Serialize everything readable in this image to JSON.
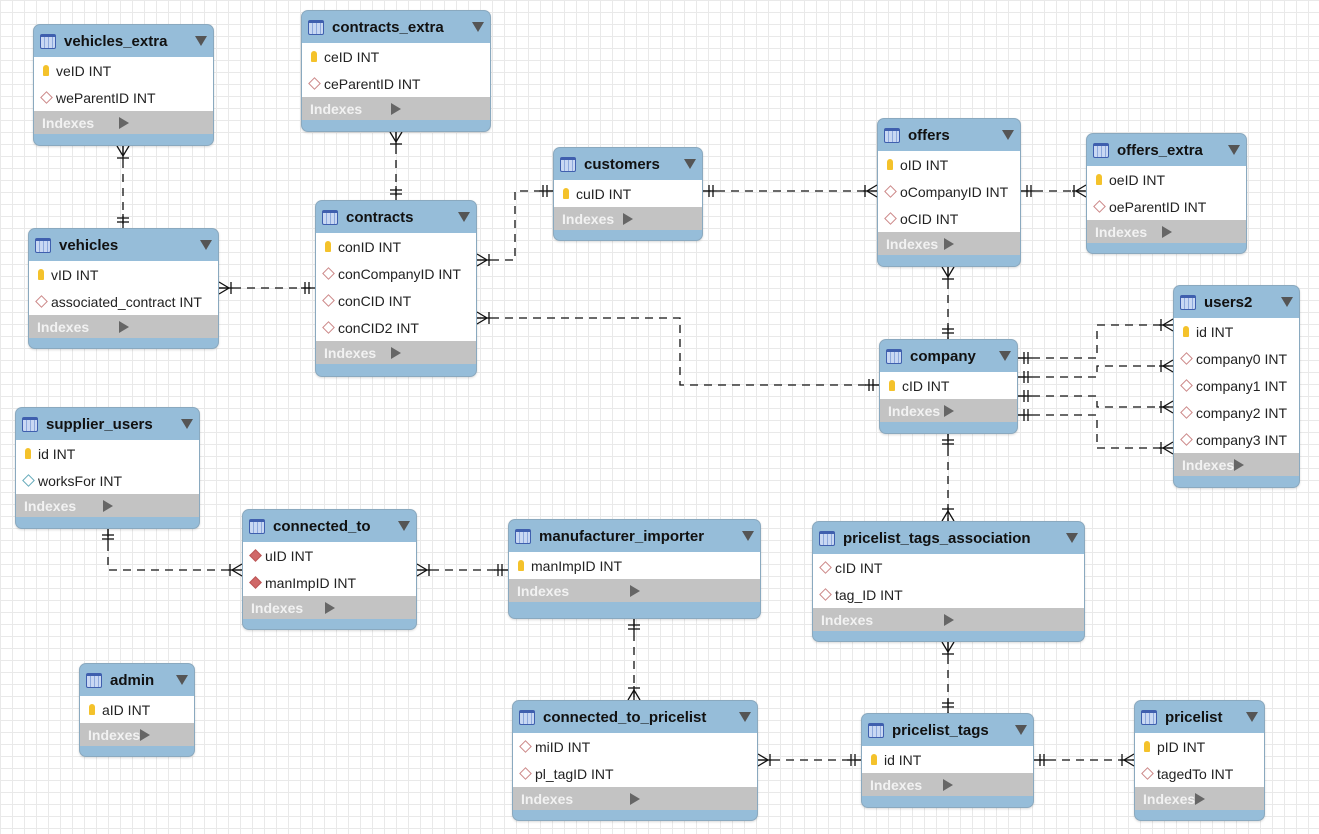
{
  "indexes_label": "Indexes",
  "colors": {
    "header": "#96bdd9",
    "indexes": "#c3c3c3",
    "key": "#f4c22b"
  },
  "tables": [
    {
      "name": "vehicles_extra",
      "columns": [
        {
          "label": "veID INT",
          "kind": "pk"
        },
        {
          "label": "weParentID INT",
          "kind": "col"
        }
      ]
    },
    {
      "name": "contracts_extra",
      "columns": [
        {
          "label": "ceID INT",
          "kind": "pk"
        },
        {
          "label": "ceParentID INT",
          "kind": "col"
        }
      ]
    },
    {
      "name": "vehicles",
      "columns": [
        {
          "label": "vID INT",
          "kind": "pk"
        },
        {
          "label": "associated_contract INT",
          "kind": "col"
        }
      ]
    },
    {
      "name": "contracts",
      "columns": [
        {
          "label": "conID INT",
          "kind": "pk"
        },
        {
          "label": "conCompanyID INT",
          "kind": "col"
        },
        {
          "label": "conCID INT",
          "kind": "col"
        },
        {
          "label": "conCID2 INT",
          "kind": "col"
        }
      ]
    },
    {
      "name": "customers",
      "columns": [
        {
          "label": "cuID INT",
          "kind": "pk"
        }
      ]
    },
    {
      "name": "offers",
      "columns": [
        {
          "label": "oID INT",
          "kind": "pk"
        },
        {
          "label": "oCompanyID INT",
          "kind": "col"
        },
        {
          "label": "oCID INT",
          "kind": "col"
        }
      ]
    },
    {
      "name": "offers_extra",
      "columns": [
        {
          "label": "oeID INT",
          "kind": "pk"
        },
        {
          "label": "oeParentID INT",
          "kind": "col"
        }
      ]
    },
    {
      "name": "users2",
      "columns": [
        {
          "label": "id INT",
          "kind": "pk"
        },
        {
          "label": "company0 INT",
          "kind": "col"
        },
        {
          "label": "company1 INT",
          "kind": "col"
        },
        {
          "label": "company2 INT",
          "kind": "col"
        },
        {
          "label": "company3 INT",
          "kind": "col"
        }
      ]
    },
    {
      "name": "company",
      "columns": [
        {
          "label": "cID INT",
          "kind": "pk"
        }
      ]
    },
    {
      "name": "supplier_users",
      "columns": [
        {
          "label": "id INT",
          "kind": "pk"
        },
        {
          "label": "worksFor INT",
          "kind": "nn"
        }
      ]
    },
    {
      "name": "connected_to",
      "columns": [
        {
          "label": "uID INT",
          "kind": "fk"
        },
        {
          "label": "manImpID INT",
          "kind": "fk"
        }
      ]
    },
    {
      "name": "manufacturer_importer",
      "columns": [
        {
          "label": "manImpID INT",
          "kind": "pk"
        }
      ]
    },
    {
      "name": "pricelist_tags_association",
      "columns": [
        {
          "label": "cID INT",
          "kind": "col"
        },
        {
          "label": "tag_ID INT",
          "kind": "col"
        }
      ]
    },
    {
      "name": "admin",
      "columns": [
        {
          "label": "aID INT",
          "kind": "pk"
        }
      ]
    },
    {
      "name": "connected_to_pricelist",
      "columns": [
        {
          "label": "miID INT",
          "kind": "col"
        },
        {
          "label": "pl_tagID INT",
          "kind": "col"
        }
      ]
    },
    {
      "name": "pricelist_tags",
      "columns": [
        {
          "label": "id INT",
          "kind": "pk"
        }
      ]
    },
    {
      "name": "pricelist",
      "columns": [
        {
          "label": "pID INT",
          "kind": "pk"
        },
        {
          "label": "tagedTo INT",
          "kind": "col"
        }
      ]
    }
  ]
}
